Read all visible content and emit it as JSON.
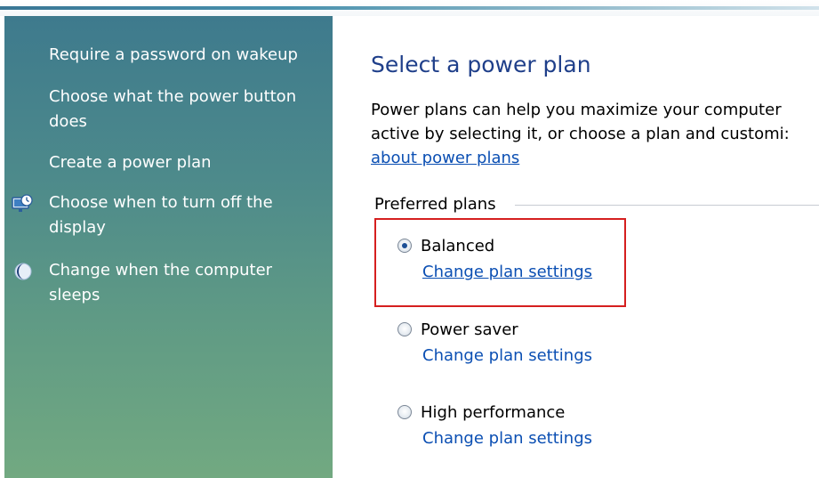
{
  "sidebar": {
    "items": [
      {
        "label": "Require a password on wakeup"
      },
      {
        "label_line1": "Choose what the power button",
        "label_line2": "does"
      },
      {
        "label": "Create a power plan"
      },
      {
        "label_line1": "Choose when to turn off the",
        "label_line2": "display",
        "icon": "display-clock-icon"
      },
      {
        "label_line1": "Change when the computer",
        "label_line2": "sleeps",
        "icon": "moon-icon"
      }
    ]
  },
  "main": {
    "title": "Select a power plan",
    "description_line1": "Power plans can help you maximize your computer",
    "description_line2": "active by selecting it, or choose a plan and customi:",
    "description_link": "about power plans",
    "group_label": "Preferred plans",
    "plans": [
      {
        "name": "Balanced",
        "selected": true,
        "link": "Change plan settings"
      },
      {
        "name": "Power saver",
        "selected": false,
        "link": "Change plan settings"
      },
      {
        "name": "High performance",
        "selected": false,
        "link": "Change plan settings"
      }
    ]
  },
  "colors": {
    "sidebar_top": "#3e7a8d",
    "sidebar_bottom": "#72a981",
    "title": "#1f3f8a",
    "link": "#0b4fb3",
    "highlight": "#d51f1f"
  }
}
